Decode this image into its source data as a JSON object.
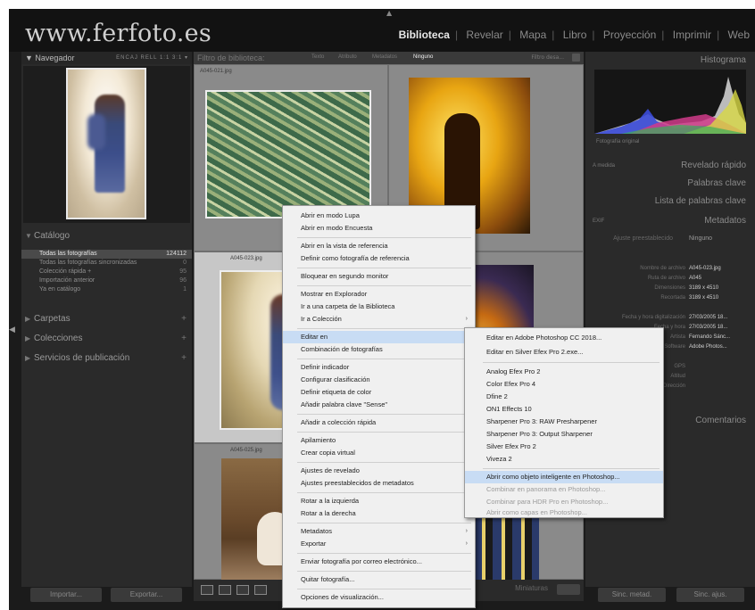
{
  "brand": "www.ferfoto.es",
  "modules": [
    "Biblioteca",
    "Revelar",
    "Mapa",
    "Libro",
    "Proyección",
    "Imprimir",
    "Web"
  ],
  "navigator": {
    "title": "Navegador",
    "options": "ENCAJ   RELL   1:1   3:1 ▾"
  },
  "left_sections": {
    "catalog": "Catálogo",
    "folders": "Carpetas",
    "collections": "Colecciones",
    "publish": "Servicios de publicación"
  },
  "catalog_items": [
    {
      "label": "Todas las fotografías",
      "count": "124112"
    },
    {
      "label": "Todas las fotografías sincronizadas",
      "count": "0"
    },
    {
      "label": "Colección rápida +",
      "count": "95"
    },
    {
      "label": "Importación anterior",
      "count": "96"
    },
    {
      "label": "Ya en catálogo",
      "count": "1"
    }
  ],
  "filter": {
    "label": "Filtro de biblioteca:",
    "chips": [
      "Texto",
      "Atributo",
      "Metadatos",
      "Ninguno"
    ],
    "preset": "Filtro desa..."
  },
  "thumbs": {
    "a": "A045-021.jpg",
    "b": "A045-023.jpg",
    "c": "A045-025.jpg"
  },
  "left_buttons": {
    "import": "Importar...",
    "export": "Exportar..."
  },
  "bottombar": {
    "thumbs_label": "Miniaturas"
  },
  "right": {
    "histogram": "Histograma",
    "orig": "Fotografía original",
    "quick_dev": "Revelado rápido",
    "quick_dev_sel": "A medida",
    "keywords": "Palabras clave",
    "keyword_list": "Lista de palabras clave",
    "metadata": "Metadatos",
    "metadata_sel": "EXIF",
    "preset_label": "Ajuste preestablecido",
    "preset_value": "Ninguno",
    "comments": "Comentarios",
    "sync_meta": "Sinc. metad.",
    "sync_settings": "Sinc. ajus."
  },
  "meta_rows": [
    {
      "k": "Nombre de archivo",
      "v": "A045-023.jpg"
    },
    {
      "k": "Ruta de archivo",
      "v": "A045"
    },
    {
      "k": "Dimensiones",
      "v": "3189 x 4510"
    },
    {
      "k": "Recortada",
      "v": "3189 x 4510"
    },
    {
      "k": "",
      "v": ""
    },
    {
      "k": "Fecha y hora digitalización",
      "v": "27/03/2005 18..."
    },
    {
      "k": "Fecha y hora",
      "v": "27/03/2005 18..."
    },
    {
      "k": "Artista",
      "v": "Fernando Sánc..."
    },
    {
      "k": "Software",
      "v": "Adobe Photos..."
    },
    {
      "k": "",
      "v": ""
    },
    {
      "k": "GPS",
      "v": ""
    },
    {
      "k": "Altitud",
      "v": ""
    },
    {
      "k": "Dirección",
      "v": ""
    }
  ],
  "menu": [
    "Abrir en modo Lupa",
    "Abrir en modo Encuesta",
    "Abrir en la vista de referencia",
    "Definir como fotografía de referencia",
    "Bloquear en segundo monitor",
    "Mostrar en Explorador",
    "Ir a una carpeta de la Biblioteca",
    "Ir a Colección",
    "Editar en",
    "Combinación de fotografías",
    "Definir indicador",
    "Configurar clasificación",
    "Definir etiqueta de color",
    "Añadir palabra clave \"Sense\"",
    "Añadir a colección rápida",
    "Apilamiento",
    "Crear copia virtual",
    "Ajustes de revelado",
    "Ajustes preestablecidos de metadatos",
    "Rotar a la izquierda",
    "Rotar a la derecha",
    "Metadatos",
    "Exportar",
    "Enviar fotografía por correo electrónico...",
    "Quitar fotografía...",
    "Opciones de visualización..."
  ],
  "submenu": [
    "Editar en Adobe Photoshop CC 2018...",
    "Editar en Silver Efex Pro 2.exe...",
    "Analog Efex Pro 2",
    "Color Efex Pro 4",
    "Dfine 2",
    "ON1 Effects 10",
    "Sharpener Pro 3: RAW Presharpener",
    "Sharpener Pro 3: Output Sharpener",
    "Silver Efex Pro 2",
    "Viveza 2",
    "Abrir como objeto inteligente en Photoshop...",
    "Combinar en panorama en Photoshop...",
    "Combinar para HDR Pro en Photoshop...",
    "Abrir como capas en Photoshop..."
  ]
}
